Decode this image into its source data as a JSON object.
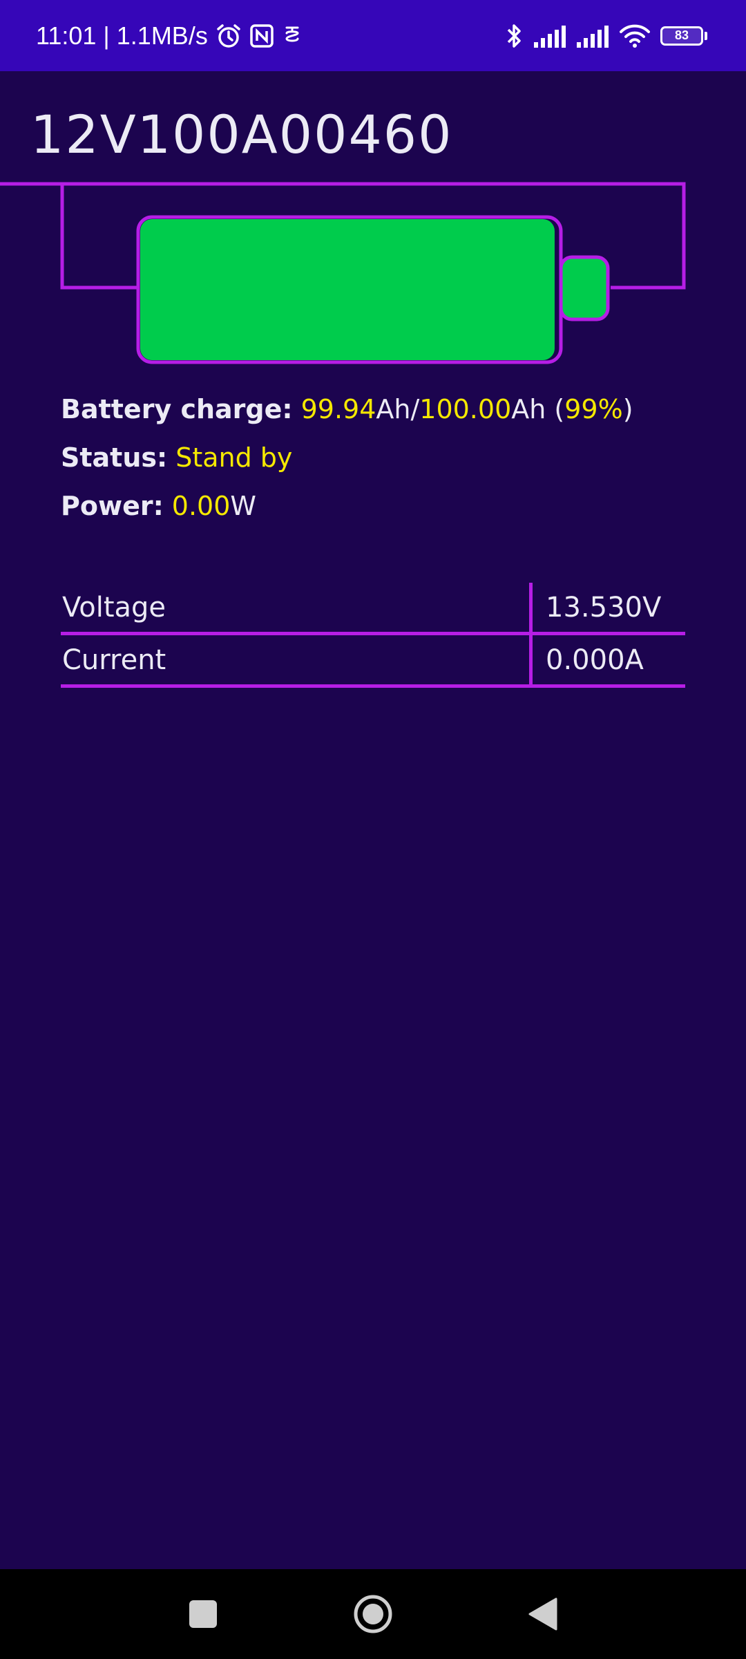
{
  "status_bar": {
    "time_speed": "11:01 | 1.1MB/s",
    "battery_level": "83",
    "icons": [
      "alarm-icon",
      "nfc-icon",
      "app-notification-icon",
      "bluetooth-icon",
      "signal-icon",
      "signal-icon",
      "wifi-icon",
      "battery-icon"
    ]
  },
  "device": {
    "title": "12V100A00460"
  },
  "battery": {
    "fill_percent": 99,
    "fill_color": "#00cc4c",
    "outline_color": "#b61ee6"
  },
  "info": {
    "charge_label": "Battery charge:",
    "charge_current": "99.94",
    "charge_current_unit": "Ah/",
    "charge_capacity": "100.00",
    "charge_capacity_unit": "Ah",
    "charge_open_paren": " (",
    "charge_percent": "99%",
    "charge_close_paren": ")",
    "status_label": "Status:",
    "status_value": "Stand by",
    "power_label": "Power:",
    "power_value": "0.00",
    "power_unit": "W"
  },
  "readings": [
    {
      "name": "Voltage",
      "value": "13.530V"
    },
    {
      "name": "Current",
      "value": "0.000A"
    }
  ],
  "colors": {
    "background": "#1c044f",
    "status_bar": "#3606b8",
    "accent": "#b61ee6",
    "highlight": "#f5e800"
  }
}
